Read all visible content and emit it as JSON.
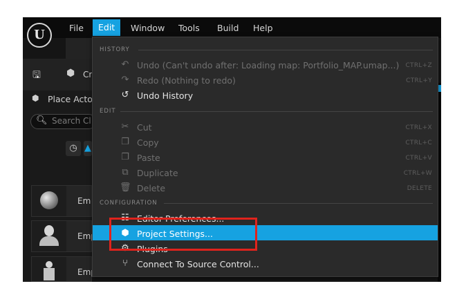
{
  "menubar": {
    "items": [
      {
        "label": "File"
      },
      {
        "label": "Edit"
      },
      {
        "label": "Window"
      },
      {
        "label": "Tools"
      },
      {
        "label": "Build"
      },
      {
        "label": "Help"
      }
    ],
    "active": "Edit"
  },
  "toolbar": {
    "create_label": "Cr"
  },
  "place_actors": {
    "label": "Place Acto",
    "search_placeholder": "Search Cl",
    "items": [
      {
        "label": "Em"
      },
      {
        "label": "Emp"
      },
      {
        "label": "Emp"
      }
    ]
  },
  "edit_menu": {
    "sections": [
      {
        "header": "HISTORY",
        "items": [
          {
            "label": "Undo (Can't undo after: Loading map: Portfolio_MAP.umap...)",
            "shortcut": "CTRL+Z",
            "icon": "undo-icon",
            "enabled": false
          },
          {
            "label": "Redo (Nothing to redo)",
            "shortcut": "CTRL+Y",
            "icon": "redo-icon",
            "enabled": false
          },
          {
            "label": "Undo History",
            "shortcut": "",
            "icon": "history-icon",
            "enabled": true
          }
        ]
      },
      {
        "header": "EDIT",
        "items": [
          {
            "label": "Cut",
            "shortcut": "CTRL+X",
            "icon": "cut-icon",
            "enabled": false
          },
          {
            "label": "Copy",
            "shortcut": "CTRL+C",
            "icon": "copy-icon",
            "enabled": false
          },
          {
            "label": "Paste",
            "shortcut": "CTRL+V",
            "icon": "paste-icon",
            "enabled": false
          },
          {
            "label": "Duplicate",
            "shortcut": "CTRL+W",
            "icon": "duplicate-icon",
            "enabled": false
          },
          {
            "label": "Delete",
            "shortcut": "DELETE",
            "icon": "trash-icon",
            "enabled": false
          }
        ]
      },
      {
        "header": "CONFIGURATION",
        "items": [
          {
            "label": "Editor Preferences...",
            "icon": "preferences-icon",
            "enabled": true
          },
          {
            "label": "Project Settings...",
            "icon": "project-settings-icon",
            "enabled": true,
            "highlighted": true
          },
          {
            "label": "Plugins",
            "icon": "plugins-icon",
            "enabled": true
          },
          {
            "label": "Connect To Source Control...",
            "icon": "source-control-icon",
            "enabled": true
          }
        ]
      }
    ]
  },
  "colors": {
    "accent": "#16a2e1",
    "callout": "#e0231c",
    "menu_bg": "#2a2a2a"
  }
}
